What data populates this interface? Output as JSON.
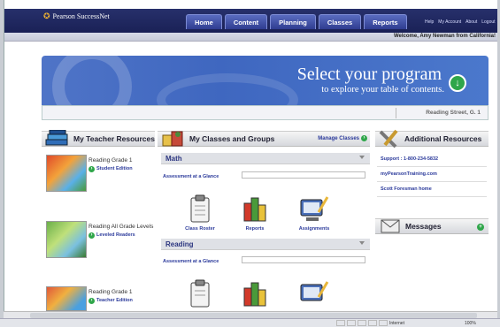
{
  "header": {
    "logo": "Pearson SuccessNet",
    "tabs": [
      {
        "label": "Home"
      },
      {
        "label": "Content"
      },
      {
        "label": "Planning"
      },
      {
        "label": "Classes"
      },
      {
        "label": "Reports"
      }
    ],
    "utility_links": [
      "Help",
      "My Account",
      "About",
      "Logout"
    ],
    "welcome": "Welcome, Amy Newman from California!"
  },
  "banner": {
    "title": "Select your program",
    "subtitle": "to explore your table of contents.",
    "program": "Reading Street, G. 1"
  },
  "teacher_resources": {
    "title": "My Teacher Resources",
    "items": [
      {
        "title": "Reading Grade 1",
        "link": "Student Edition"
      },
      {
        "title": "Reading All Grade Levels",
        "link": "Leveled Readers"
      },
      {
        "title": "Reading Grade 1",
        "link": "Teacher Edition"
      }
    ]
  },
  "classes": {
    "title": "My Classes and Groups",
    "manage": "Manage Classes",
    "subjects": [
      {
        "name": "Math",
        "aag_label": "Assessment at a Glance",
        "tools": [
          "Class Roster",
          "Reports",
          "Assignments"
        ]
      },
      {
        "name": "Reading",
        "aag_label": "Assessment at a Glance"
      }
    ]
  },
  "additional_resources": {
    "title": "Additional Resources",
    "links": [
      "Support : 1-800-234-5832",
      "myPearsonTraining.com",
      "Scott Foresman home"
    ]
  },
  "messages": {
    "title": "Messages"
  },
  "status": {
    "zone": "Internet",
    "zoom": "100%"
  },
  "colors": {
    "nav": "#1a2156",
    "accent_green": "#2fa64a",
    "banner_blue": "#4f74c7",
    "link_blue": "#2b3a9b"
  }
}
